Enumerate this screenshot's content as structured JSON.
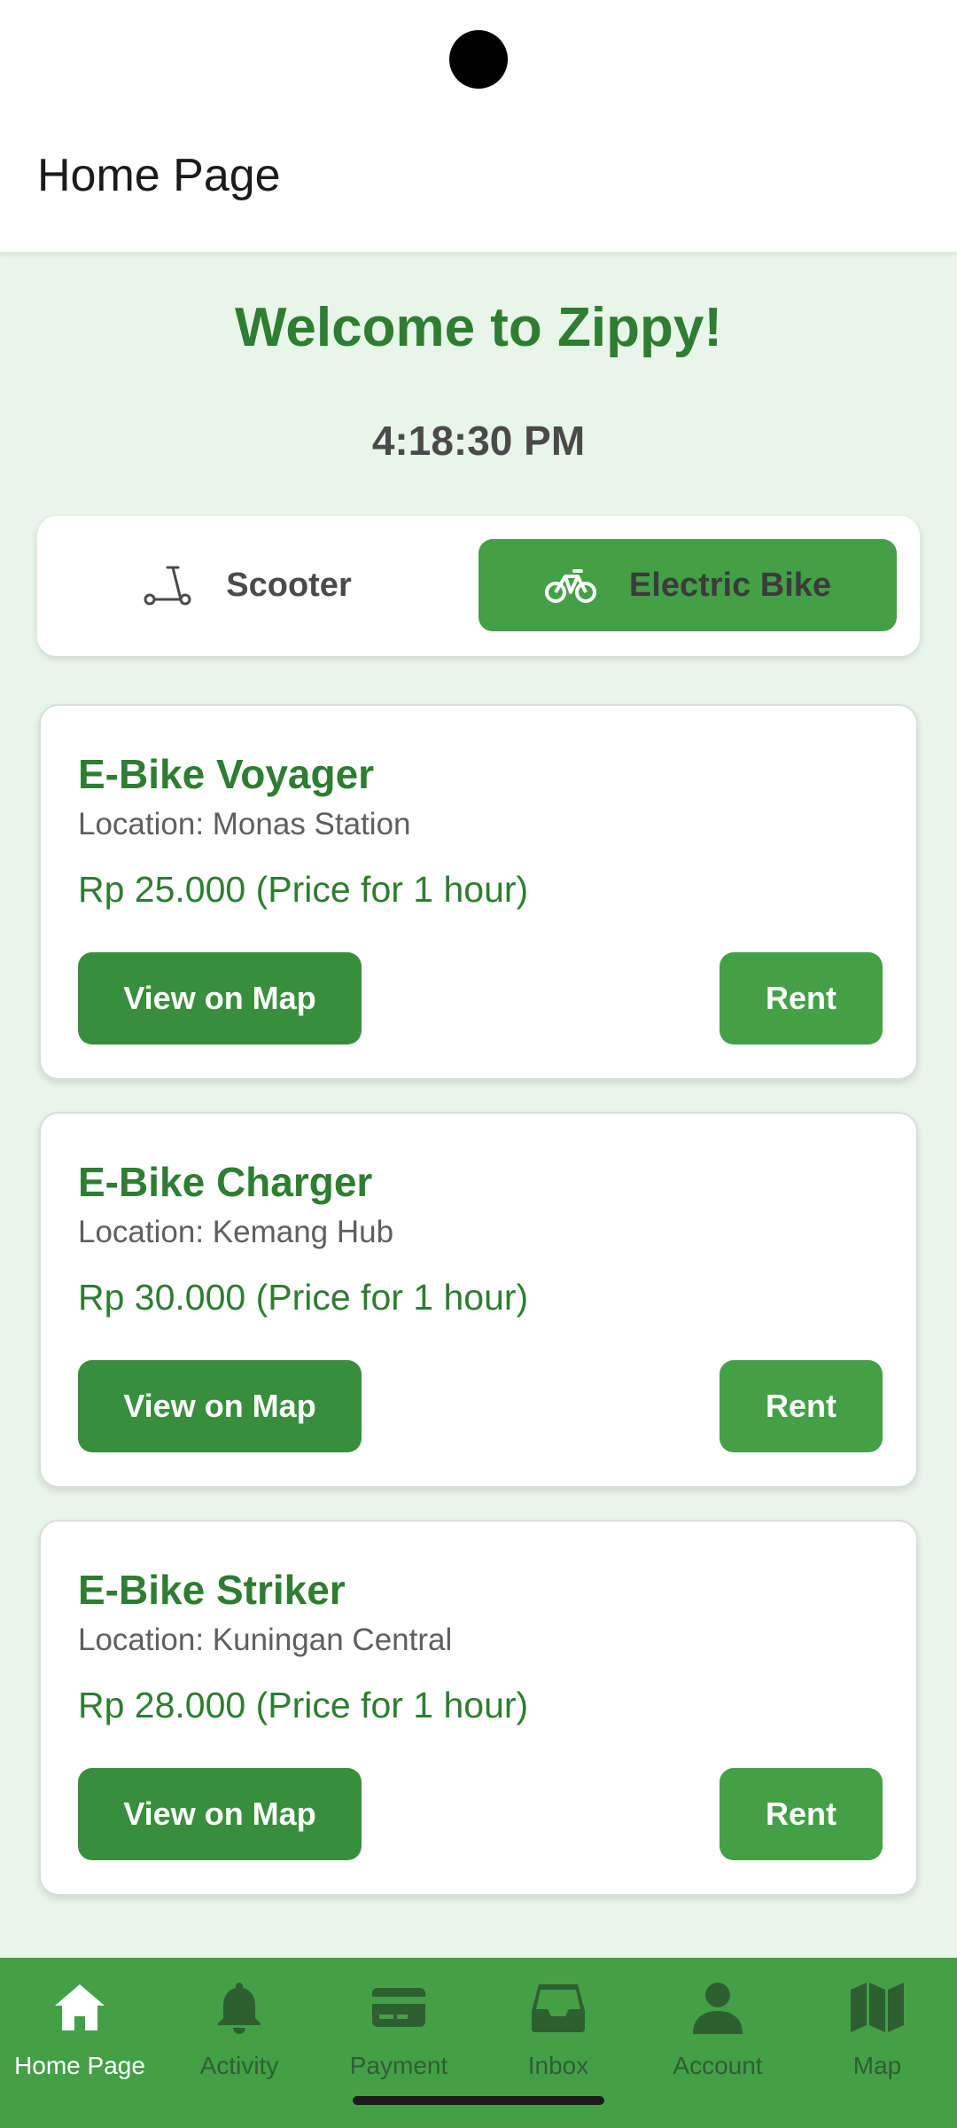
{
  "header": {
    "title": "Home Page"
  },
  "welcome": "Welcome to Zippy!",
  "clock": "4:18:30 PM",
  "segment": {
    "options": [
      {
        "label": "Scooter",
        "icon": "scooter-icon",
        "selected": false
      },
      {
        "label": "Electric Bike",
        "icon": "bicycle-icon",
        "selected": true
      }
    ]
  },
  "cards": [
    {
      "name": "E-Bike Voyager",
      "location": "Location: Monas Station",
      "price": "Rp 25.000 (Price for 1 hour)",
      "map_label": "View on Map",
      "rent_label": "Rent"
    },
    {
      "name": "E-Bike Charger",
      "location": "Location: Kemang Hub",
      "price": "Rp 30.000 (Price for 1 hour)",
      "map_label": "View on Map",
      "rent_label": "Rent"
    },
    {
      "name": "E-Bike Striker",
      "location": "Location: Kuningan Central",
      "price": "Rp 28.000 (Price for 1 hour)",
      "map_label": "View on Map",
      "rent_label": "Rent"
    }
  ],
  "nav": [
    {
      "label": "Home Page",
      "icon": "home-icon",
      "active": true
    },
    {
      "label": "Activity",
      "icon": "bell-icon",
      "active": false
    },
    {
      "label": "Payment",
      "icon": "credit-card-icon",
      "active": false
    },
    {
      "label": "Inbox",
      "icon": "inbox-icon",
      "active": false
    },
    {
      "label": "Account",
      "icon": "person-icon",
      "active": false
    },
    {
      "label": "Map",
      "icon": "map-icon",
      "active": false
    }
  ],
  "colors": {
    "primary": "#43a047",
    "primary_dark": "#388e3c",
    "title_green": "#2e7d32",
    "background": "#e8f5e9",
    "nav_inactive": "#2e5f31"
  }
}
